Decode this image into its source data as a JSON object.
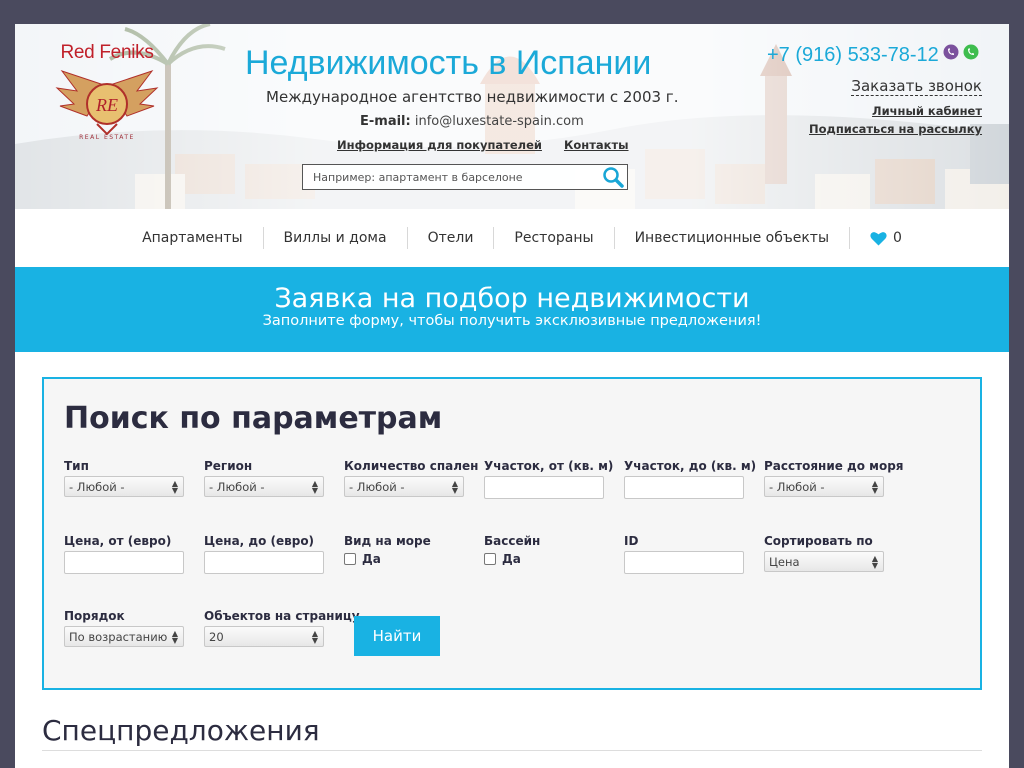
{
  "header": {
    "logo_text": "Red Feniks",
    "logo_sub": "REAL ESTATE",
    "title": "Недвижимость в Испании",
    "subtitle": "Международное агентство недвижимости с 2003 г.",
    "email_label": "E-mail:",
    "email_value": "info@luxestate-spain.com",
    "link_buyers": "Информация для покупателей",
    "link_contacts": "Контакты",
    "search_placeholder": "Например: апартамент в барселоне",
    "phone": "+7 (916) 533-78-12",
    "callback": "Заказать звонок",
    "cabinet": "Личный кабинет",
    "subscribe": "Подписаться на рассылку"
  },
  "nav": {
    "items": [
      "Апартаменты",
      "Виллы и дома",
      "Отели",
      "Рестораны",
      "Инвестиционные объекты"
    ],
    "favorites_count": "0"
  },
  "banner": {
    "title": "Заявка на подбор недвижимости",
    "subtitle": "Заполните форму, чтобы получить эксклюзивные предложения!"
  },
  "form": {
    "title": "Поиск по параметрам",
    "type_label": "Тип",
    "type_value": "- Любой -",
    "region_label": "Регион",
    "region_value": "- Любой -",
    "bedrooms_label": "Количество спален",
    "bedrooms_value": "- Любой -",
    "plot_from_label": "Участок, от (кв. м)",
    "plot_to_label": "Участок, до (кв. м)",
    "sea_distance_label": "Расстояние до моря",
    "sea_distance_value": "- Любой -",
    "price_from_label": "Цена, от (евро)",
    "price_to_label": "Цена, до (евро)",
    "sea_view_label": "Вид на море",
    "sea_view_option": "Да",
    "pool_label": "Бассейн",
    "pool_option": "Да",
    "id_label": "ID",
    "sort_label": "Сортировать по",
    "sort_value": "Цена",
    "order_label": "Порядок",
    "order_value": "По возрастанию",
    "per_page_label": "Объектов на страницу",
    "per_page_value": "20",
    "submit": "Найти"
  },
  "specials_title": "Спецпредложения",
  "colors": {
    "accent": "#19b2e3",
    "brand_red": "#c0202a",
    "frame": "#4a4a5e"
  }
}
